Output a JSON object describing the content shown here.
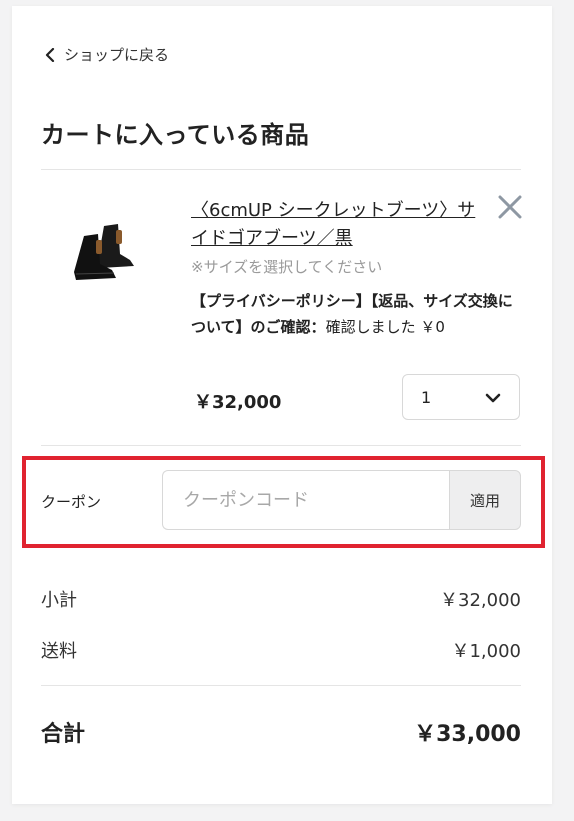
{
  "nav": {
    "back_label": "ショップに戻る"
  },
  "cart": {
    "title": "カートに入っている商品"
  },
  "item": {
    "name": "〈6cmUP シークレットブーツ〉サイドゴアブーツ／黒",
    "size_note": "※サイズを選択してください",
    "option_label": "【プライバシーポリシー】【返品、サイズ交換について】のご確認：",
    "option_value": "確認しました ￥0",
    "price": "￥32,000",
    "quantity": "1"
  },
  "coupon": {
    "label": "クーポン",
    "placeholder": "クーポンコード",
    "apply_label": "適用",
    "highlight_color": "#e02330"
  },
  "summary": {
    "subtotal_label": "小計",
    "subtotal_value": "￥32,000",
    "shipping_label": "送料",
    "shipping_value": "￥1,000",
    "total_label": "合計",
    "total_value": "￥33,000"
  },
  "icons": {
    "back": "chevron-left-icon",
    "remove": "close-icon",
    "qty": "chevron-down-icon"
  }
}
